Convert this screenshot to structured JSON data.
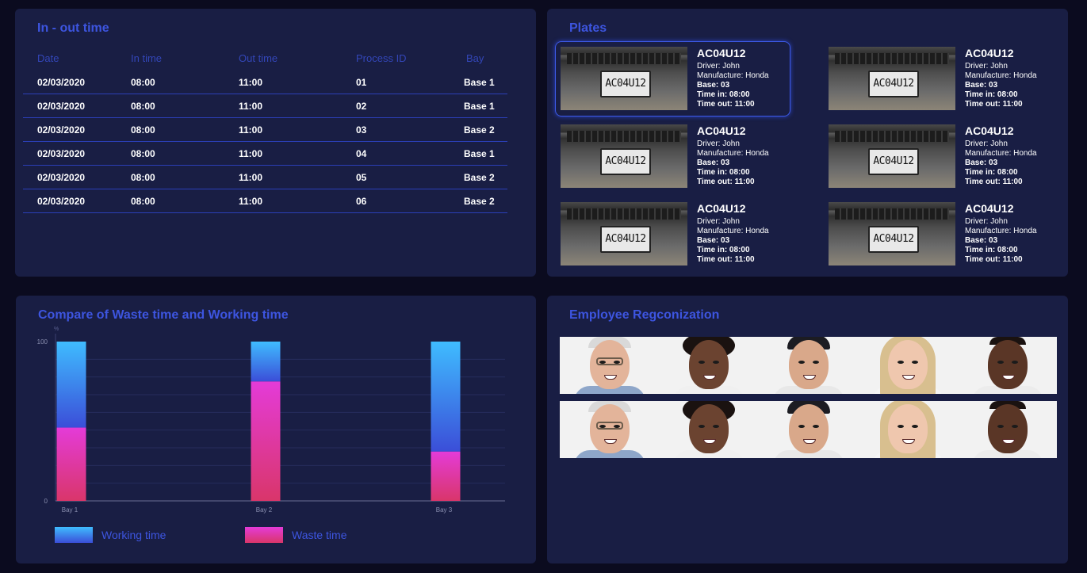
{
  "inout": {
    "title": "In - out time",
    "columns": [
      "Date",
      "In time",
      "Out time",
      "Process ID",
      "Bay"
    ],
    "rows": [
      [
        "02/03/2020",
        "08:00",
        "11:00",
        "01",
        "Base 1"
      ],
      [
        "02/03/2020",
        "08:00",
        "11:00",
        "02",
        "Base 1"
      ],
      [
        "02/03/2020",
        "08:00",
        "11:00",
        "03",
        "Base 2"
      ],
      [
        "02/03/2020",
        "08:00",
        "11:00",
        "04",
        "Base 1"
      ],
      [
        "02/03/2020",
        "08:00",
        "11:00",
        "05",
        "Base 2"
      ],
      [
        "02/03/2020",
        "08:00",
        "11:00",
        "06",
        "Base 2"
      ]
    ]
  },
  "plates": {
    "title": "Plates",
    "items": [
      {
        "plate_text": "AC04U12",
        "code": "AC04U12",
        "driver": "Driver: John",
        "manufacture": "Manufacture: Honda",
        "base": "Base: 03",
        "time_in": "Time in: 08:00",
        "time_out": "Time out: 11:00",
        "selected": true
      },
      {
        "plate_text": "AC04U12",
        "code": "AC04U12",
        "driver": "Driver: John",
        "manufacture": "Manufacture: Honda",
        "base": "Base: 03",
        "time_in": "Time in: 08:00",
        "time_out": "Time out: 11:00",
        "selected": false
      },
      {
        "plate_text": "AC04U12",
        "code": "AC04U12",
        "driver": "Driver: John",
        "manufacture": "Manufacture: Honda",
        "base": "Base: 03",
        "time_in": "Time in: 08:00",
        "time_out": "Time out: 11:00",
        "selected": false
      },
      {
        "plate_text": "AC04U12",
        "code": "AC04U12",
        "driver": "Driver: John",
        "manufacture": "Manufacture: Honda",
        "base": "Base: 03",
        "time_in": "Time in: 08:00",
        "time_out": "Time out: 11:00",
        "selected": false
      },
      {
        "plate_text": "AC04U12",
        "code": "AC04U12",
        "driver": "Driver: John",
        "manufacture": "Manufacture: Honda",
        "base": "Base: 03",
        "time_in": "Time in: 08:00",
        "time_out": "Time out: 11:00",
        "selected": false
      },
      {
        "plate_text": "AC04U12",
        "code": "AC04U12",
        "driver": "Driver: John",
        "manufacture": "Manufacture: Honda",
        "base": "Base: 03",
        "time_in": "Time in: 08:00",
        "time_out": "Time out: 11:00",
        "selected": false
      }
    ]
  },
  "chart": {
    "title": "Compare of Waste time and Working time"
  },
  "chart_data": {
    "type": "bar",
    "stacked": true,
    "categories": [
      "Bay 1",
      "Bay 2",
      "Bay 3"
    ],
    "series": [
      {
        "name": "Waste time",
        "values": [
          46,
          75,
          31
        ],
        "gradient": [
          "#e43bd8",
          "#d9366a"
        ]
      },
      {
        "name": "Working time",
        "values": [
          54,
          25,
          69
        ],
        "gradient": [
          "#3fbcff",
          "#3b4ed8"
        ]
      }
    ],
    "ylabel": "%",
    "ylim": [
      0,
      100
    ],
    "yticks": [
      0,
      100
    ],
    "grid": true,
    "legend": "bottom-left"
  },
  "legend": {
    "working_label": "Working time",
    "waste_label": "Waste time"
  },
  "employees": {
    "title": "Employee Regconization",
    "rows": [
      [
        "elderly-man-with-glasses",
        "young-woman-curly-hair",
        "man-with-cap",
        "blonde-woman",
        "young-man"
      ],
      [
        "elderly-man-with-glasses",
        "young-woman-curly-hair",
        "man-with-cap",
        "blonde-woman",
        "young-man"
      ]
    ]
  },
  "colors": {
    "background": "#0b0b1f",
    "panel": "#191e44",
    "accent": "#3d55e0"
  }
}
